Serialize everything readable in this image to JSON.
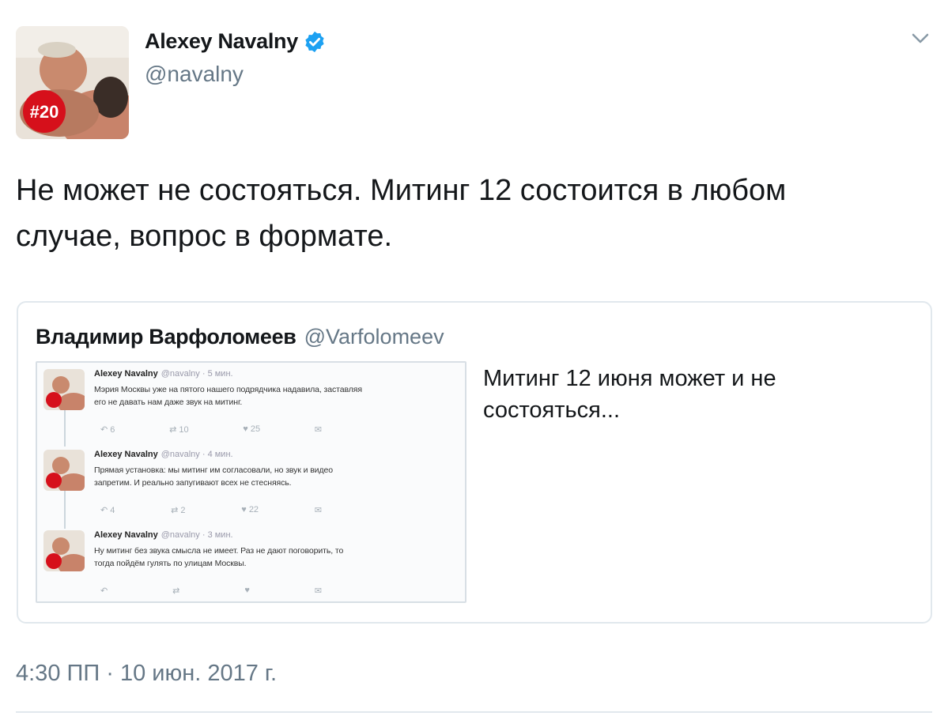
{
  "tweet": {
    "author": {
      "name": "Alexey Navalny",
      "handle": "@navalny",
      "avatar_badge": "#20",
      "verified": true
    },
    "text": "Не может не состояться. Митинг 12 состоится в любом случае, вопрос в формате.",
    "timestamp": "4:30 ПП · 10 июн. 2017 г.",
    "menu_icon": "chevron-down-icon"
  },
  "quoted_tweet": {
    "author_name": "Владимир Варфоломеев",
    "author_handle": "@Varfolomeev",
    "text": "Митинг 12 июня может и не состояться...",
    "embedded_screenshot": {
      "tweets": [
        {
          "name": "Alexey Navalny",
          "meta": "@navalny · 5 мин.",
          "lines": [
            "Мэрия Москвы уже на пятого нашего подрядчика надавила, заставляя",
            "его не давать нам даже звук на митинг."
          ],
          "actions": [
            "6",
            "10",
            "25",
            ""
          ]
        },
        {
          "name": "Alexey Navalny",
          "meta": "@navalny · 4 мин.",
          "lines": [
            "Прямая установка: мы митинг им согласовали, но звук и видео",
            "запретим. И реально запугивают всех не стесняясь."
          ],
          "actions": [
            "4",
            "2",
            "22",
            ""
          ]
        },
        {
          "name": "Alexey Navalny",
          "meta": "@navalny · 3 мин.",
          "lines": [
            "Ну митинг без звука смысла не имеет. Раз не дают поговорить, то",
            "тогда пойдём гулять по улицам Москвы."
          ],
          "actions": [
            "",
            "",
            "",
            ""
          ]
        }
      ]
    }
  },
  "colors": {
    "text_primary": "#14171a",
    "text_secondary": "#657786",
    "verified_blue": "#1da1f2",
    "border": "#e1e8ed",
    "badge_red": "#d6101b"
  }
}
